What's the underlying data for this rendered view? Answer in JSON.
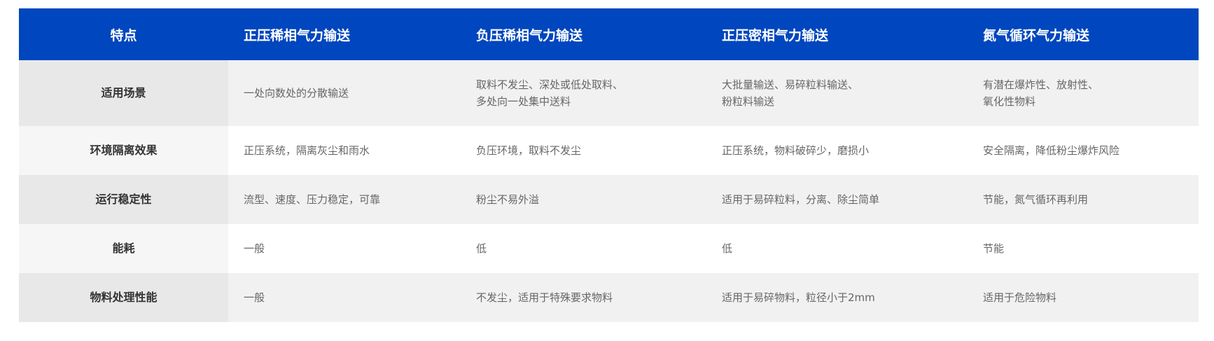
{
  "table": {
    "headers": [
      "特点",
      "正压稀相气力输送",
      "负压稀相气力输送",
      "正压密相气力输送",
      "氮气循环气力输送"
    ],
    "rows": [
      {
        "label": "适用场景",
        "cells": [
          "一处向数处的分散输送",
          "取料不发尘、深处或低处取料、\n多处向一处集中送料",
          "大批量输送、易碎粒料输送、\n粉粒料输送",
          "有潜在爆炸性、放射性、\n氧化性物料"
        ]
      },
      {
        "label": "环境隔离效果",
        "cells": [
          "正压系统，隔离灰尘和雨水",
          "负压环境，取料不发尘",
          "正压系统，物料破碎少，磨损小",
          "安全隔离，降低粉尘爆炸风险"
        ]
      },
      {
        "label": "运行稳定性",
        "cells": [
          "流型、速度、压力稳定，可靠",
          "粉尘不易外溢",
          "适用于易碎粒料，分离、除尘简单",
          "节能，氮气循环再利用"
        ]
      },
      {
        "label": "能耗",
        "cells": [
          "一般",
          "低",
          "低",
          "节能"
        ]
      },
      {
        "label": "物料处理性能",
        "cells": [
          "一般",
          "不发尘，适用于特殊要求物料",
          "适用于易碎物料，粒径小于2mm",
          "适用于危险物料"
        ]
      }
    ]
  }
}
